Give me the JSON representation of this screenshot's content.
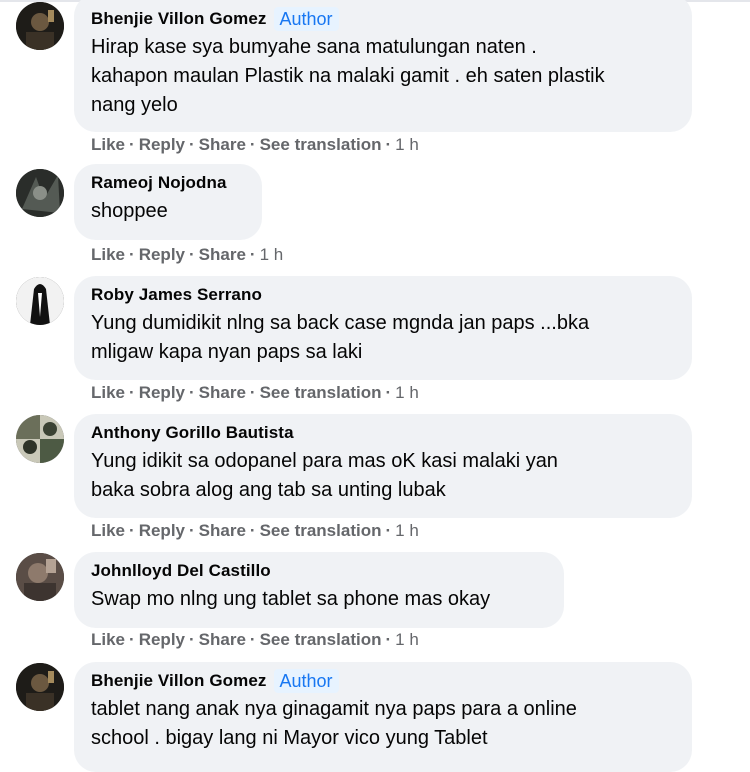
{
  "comments": [
    {
      "author": "Bhenjie Villon Gomez",
      "badge": "Author",
      "lines": [
        "Hirap kase sya bumyahe sana matulungan naten .",
        "kahapon maulan Plastik na malaki gamit . eh saten plastik",
        "nang yelo"
      ],
      "actions": {
        "like": "Like",
        "reply": "Reply",
        "share": "Share",
        "translate": "See translation",
        "time": "1 h"
      }
    },
    {
      "author": "Rameoj Nojodna",
      "lines": [
        "shoppee"
      ],
      "actions": {
        "like": "Like",
        "reply": "Reply",
        "share": "Share",
        "time": "1 h"
      }
    },
    {
      "author": "Roby James Serrano",
      "lines": [
        "Yung dumidikit nlng sa back case mgnda jan paps ...bka",
        "mligaw kapa nyan paps sa laki"
      ],
      "actions": {
        "like": "Like",
        "reply": "Reply",
        "share": "Share",
        "translate": "See translation",
        "time": "1 h"
      }
    },
    {
      "author": "Anthony Gorillo Bautista",
      "lines": [
        "Yung idikit sa odopanel para mas oK kasi malaki yan",
        "baka sobra alog ang tab sa unting lubak"
      ],
      "actions": {
        "like": "Like",
        "reply": "Reply",
        "share": "Share",
        "translate": "See translation",
        "time": "1 h"
      }
    },
    {
      "author": "Johnlloyd Del Castillo",
      "lines": [
        "Swap mo nlng ung tablet sa phone mas okay"
      ],
      "actions": {
        "like": "Like",
        "reply": "Reply",
        "share": "Share",
        "translate": "See translation",
        "time": "1 h"
      }
    },
    {
      "author": "Bhenjie Villon Gomez",
      "badge": "Author",
      "lines": [
        "tablet nang anak nya ginagamit nya paps para a online",
        "school . bigay lang ni Mayor vico yung Tablet"
      ]
    }
  ],
  "separator": "·",
  "colors": {
    "bubble": "#f0f2f5",
    "badge_bg": "#e7f3ff",
    "badge_text": "#1877f2",
    "meta": "#65676b"
  }
}
